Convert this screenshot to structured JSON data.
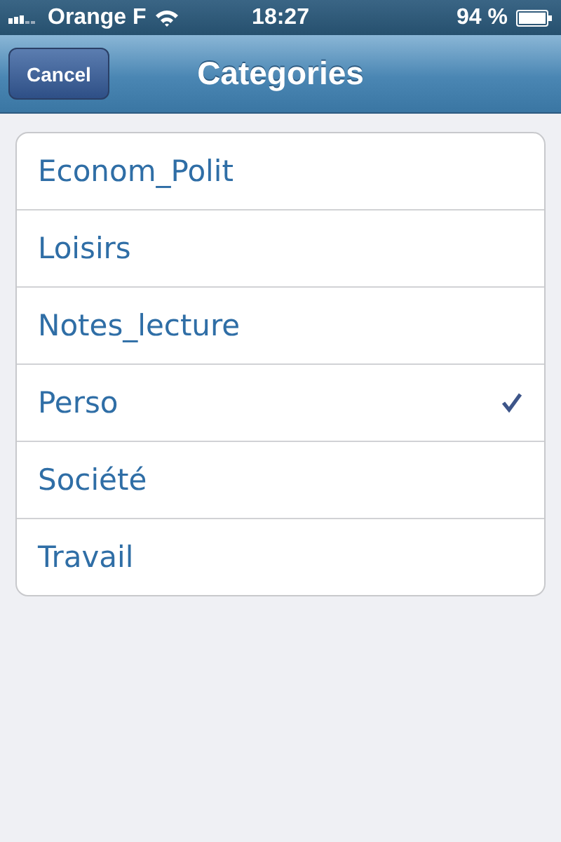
{
  "status_bar": {
    "carrier": "Orange F",
    "time": "18:27",
    "battery": "94 %"
  },
  "nav_bar": {
    "title": "Categories",
    "cancel": "Cancel"
  },
  "categories": [
    {
      "label": "Econom_Polit",
      "selected": false
    },
    {
      "label": "Loisirs",
      "selected": false
    },
    {
      "label": "Notes_lecture",
      "selected": false
    },
    {
      "label": "Perso",
      "selected": true
    },
    {
      "label": "Société",
      "selected": false
    },
    {
      "label": "Travail",
      "selected": false
    }
  ]
}
